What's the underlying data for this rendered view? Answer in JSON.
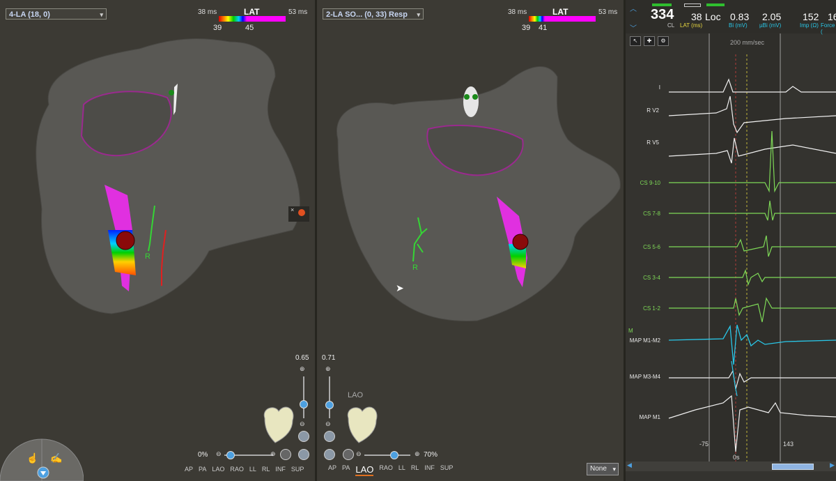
{
  "map1": {
    "select_label": "4-LA (18, 0)",
    "lat_title": "LAT",
    "lat_min": "38 ms",
    "lat_max": "53 ms",
    "lat_low": "39",
    "lat_high": "45",
    "opacity_value": "0.65",
    "zoom_value": "0%",
    "marker_label": "R"
  },
  "map2": {
    "select_label": "2-LA SO... (0, 33) Resp",
    "lat_title": "LAT",
    "lat_min": "38 ms",
    "lat_max": "53 ms",
    "lat_low": "39",
    "lat_high": "41",
    "opacity_value": "0.71",
    "zoom_value": "70%",
    "view_label": "LAO",
    "marker_label": "R",
    "none_select": "None"
  },
  "view_buttons": [
    "AP",
    "PA",
    "LAO",
    "RAO",
    "LL",
    "RL",
    "INF",
    "SUP"
  ],
  "view_buttons2_active": "LAO",
  "ecg": {
    "cl_value": "334",
    "cl_unit": "CL",
    "lat_value": "38",
    "lat_unit": "LAT (ms)",
    "loc_label": "Loc",
    "bi_value": "0.83",
    "bi_unit": "Bi (mV)",
    "ubi_value": "2.05",
    "ubi_unit": "µBi (mV)",
    "imp_value": "152",
    "imp_unit": "Imp (Ω)",
    "force_value": "16",
    "force_unit": "Force (",
    "speed": "200 mm/sec",
    "tick_left": "-75",
    "tick_right": "143",
    "tick_zero": "0s",
    "m_label": "M",
    "channels": [
      "I",
      "R V2",
      "R V5",
      "CS 9-10",
      "CS 7-8",
      "CS 5-6",
      "CS 3-4",
      "CS 1-2",
      "MAP M1-M2",
      "MAP M3-M4",
      "MAP M1"
    ]
  },
  "colors": {
    "background": "#3c3a34",
    "mesh": "#5a5954",
    "boundary": "#9a2a8e",
    "ecg_white": "#f0f0f0",
    "ecg_green": "#7ed957",
    "ecg_cyan": "#29c7e8",
    "accent_orange": "#e07020"
  }
}
